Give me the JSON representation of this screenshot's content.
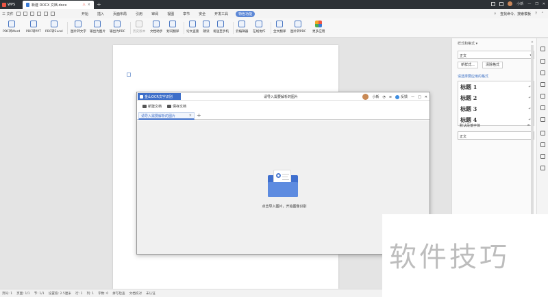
{
  "titlebar": {
    "app_name": "WPS",
    "active_tab": "新建 DOCX 文档.docx",
    "warning_mark": "⚠",
    "close_mark": "×",
    "new_tab": "+",
    "user_name": "小新"
  },
  "menubar": {
    "file_label": "三 文件",
    "tabs": [
      "开始",
      "插入",
      "页面布局",
      "引用",
      "审阅",
      "视图",
      "章节",
      "安全",
      "开发工具",
      "特色功能"
    ],
    "active_tab": "特色功能",
    "search_label": "查找命令、搜索模板",
    "help": "?"
  },
  "toolbar": {
    "tools": [
      {
        "label": "PDF转Word",
        "enabled": true
      },
      {
        "label": "PDF转PPT",
        "enabled": true
      },
      {
        "label": "PDF转Excel",
        "enabled": true
      },
      {
        "label": "图片转文字",
        "enabled": true
      },
      {
        "label": "输出为图片",
        "enabled": true
      },
      {
        "label": "输出为PDF",
        "enabled": true
      },
      {
        "label": "历史版本",
        "enabled": false
      },
      {
        "label": "文档助手",
        "enabled": true
      },
      {
        "label": "划词翻译",
        "enabled": true
      },
      {
        "label": "论文查重",
        "enabled": true
      },
      {
        "label": "朗读",
        "enabled": true
      },
      {
        "label": "发送至手机",
        "enabled": true
      },
      {
        "label": "云编辑器",
        "enabled": true
      },
      {
        "label": "在线协作",
        "enabled": true
      },
      {
        "label": "全文翻译",
        "enabled": true
      },
      {
        "label": "图片转PDF",
        "enabled": true
      },
      {
        "label": "更多应用",
        "enabled": true
      }
    ]
  },
  "sidepane": {
    "title": "样式和格式 ▾",
    "close": "×",
    "current_style": "正文",
    "new_style_button": "新样式...",
    "clear_format_button": "清除格式",
    "apply_heading": "请选择要应用的格式",
    "styles": [
      "标题 1",
      "标题 2",
      "标题 3",
      "标题 4"
    ],
    "para_mark": "↵",
    "default_font": "默认段落字体",
    "default_font_mark": "a",
    "normal": "正文"
  },
  "dialog": {
    "brand": "金山OCR文字识别",
    "title": "请导入需要解析的图片",
    "user": "小新",
    "feedback": "反馈",
    "btn_new": "新建文档",
    "btn_save": "保存文档",
    "tab_label": "请导入需要解析的图片",
    "tab_close": "×",
    "add_tab": "+",
    "hint": "点击导入图片，开始图像识别"
  },
  "statusbar": {
    "items": [
      "页码: 1",
      "页面: 1/1",
      "节: 1/1",
      "设置值: 2.5厘米",
      "行: 1",
      "列: 1",
      "字数: 0",
      "拼写检查",
      "文档校对",
      "未认证"
    ]
  },
  "watermark": "软件技巧"
}
